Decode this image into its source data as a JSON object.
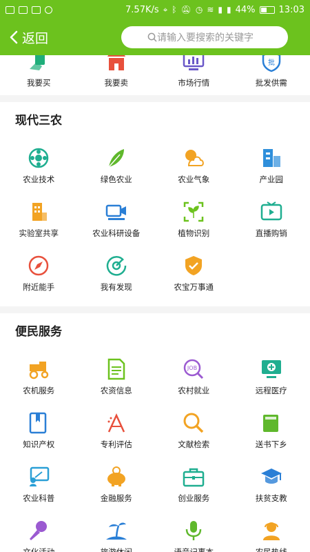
{
  "status": {
    "speed": "7.57K/s",
    "battery": "44%",
    "time": "13:03"
  },
  "header": {
    "back_label": "返回",
    "search_placeholder": "请输入要搜索的关键字"
  },
  "top_row": [
    {
      "label": "我要买",
      "icon": "hand-card-icon",
      "color": "#1fae7a"
    },
    {
      "label": "我要卖",
      "icon": "shop-icon",
      "color": "#e8503c"
    },
    {
      "label": "市场行情",
      "icon": "chart-monitor-icon",
      "color": "#6a58c8"
    },
    {
      "label": "批发供需",
      "icon": "wholesale-shield-icon",
      "color": "#2a7fd6"
    }
  ],
  "sections": [
    {
      "title": "现代三农",
      "rows": [
        [
          {
            "label": "农业技术",
            "icon": "tech-flower-icon",
            "color": "#1fae90"
          },
          {
            "label": "绿色农业",
            "icon": "leaf-icon",
            "color": "#5fb82c"
          },
          {
            "label": "农业气象",
            "icon": "weather-icon",
            "color": "#f2a323"
          },
          {
            "label": "产业园",
            "icon": "building-icon",
            "color": "#2f8fdb"
          }
        ],
        [
          {
            "label": "实验室共享",
            "icon": "lab-building-icon",
            "color": "#f2a323"
          },
          {
            "label": "农业科研设备",
            "icon": "camera-device-icon",
            "color": "#2a7fd6"
          },
          {
            "label": "植物识别",
            "icon": "plant-scan-icon",
            "color": "#6cc21e"
          },
          {
            "label": "直播购销",
            "icon": "live-tv-icon",
            "color": "#1fae90"
          }
        ],
        [
          {
            "label": "附近能手",
            "icon": "compass-icon",
            "color": "#e8503c"
          },
          {
            "label": "我有发现",
            "icon": "discover-icon",
            "color": "#1fae90"
          },
          {
            "label": "农宝万事通",
            "icon": "check-shield-icon",
            "color": "#f2a323"
          }
        ]
      ]
    },
    {
      "title": "便民服务",
      "rows": [
        [
          {
            "label": "农机服务",
            "icon": "tractor-icon",
            "color": "#f2a323"
          },
          {
            "label": "农资信息",
            "icon": "document-icon",
            "color": "#6cc21e"
          },
          {
            "label": "农村就业",
            "icon": "job-search-icon",
            "color": "#9b5ad1"
          },
          {
            "label": "远程医疗",
            "icon": "medical-monitor-icon",
            "color": "#1fae90"
          }
        ],
        [
          {
            "label": "知识产权",
            "icon": "book-icon",
            "color": "#2a7fd6"
          },
          {
            "label": "专利评估",
            "icon": "patent-icon",
            "color": "#e8503c"
          },
          {
            "label": "文献检索",
            "icon": "magnifier-icon",
            "color": "#f2a323"
          },
          {
            "label": "送书下乡",
            "icon": "green-book-icon",
            "color": "#5fb82c"
          }
        ],
        [
          {
            "label": "农业科普",
            "icon": "teach-board-icon",
            "color": "#2a9fd6"
          },
          {
            "label": "金融服务",
            "icon": "piggy-bank-icon",
            "color": "#f2a323"
          },
          {
            "label": "创业服务",
            "icon": "briefcase-icon",
            "color": "#1fae90"
          },
          {
            "label": "扶贫支教",
            "icon": "grad-cap-icon",
            "color": "#2a7fd6"
          }
        ],
        [
          {
            "label": "文化活动",
            "icon": "microphone-icon",
            "color": "#9b5ad1"
          },
          {
            "label": "旅游休闲",
            "icon": "palm-island-icon",
            "color": "#2a7fd6"
          },
          {
            "label": "语音记事本",
            "icon": "voice-mic-icon",
            "color": "#5fb82c"
          },
          {
            "label": "农民热线",
            "icon": "hotline-icon",
            "color": "#f2a323"
          }
        ]
      ]
    }
  ]
}
